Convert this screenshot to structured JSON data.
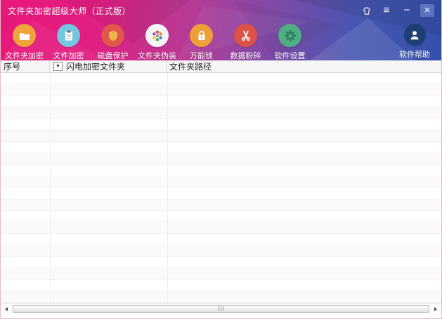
{
  "window": {
    "title": "文件夹加密超级大师（正式版）",
    "controls": {
      "menu": "≡",
      "minimize": "−",
      "close": "×"
    }
  },
  "theme": {
    "gradient_left": "#e9177a",
    "gradient_mid": "#8a48a6",
    "gradient_right": "#3350ab"
  },
  "toolbar": {
    "items": [
      {
        "label": "文件夹加密",
        "icon": "folder-icon",
        "circle_color": "#efa33d"
      },
      {
        "label": "文件加密",
        "icon": "clipboard-icon",
        "circle_color": "#74c6e1"
      },
      {
        "label": "磁盘保护",
        "icon": "shield-icon",
        "circle_color": "#e2574c"
      },
      {
        "label": "文件夹伪装",
        "icon": "color-wheel-icon",
        "circle_color": "#f4f4f4"
      },
      {
        "label": "万能锁",
        "icon": "lock-icon",
        "circle_color": "#ef9f38"
      },
      {
        "label": "数据粉碎",
        "icon": "scissors-icon",
        "circle_color": "#dc5247"
      },
      {
        "label": "软件设置",
        "icon": "gear-icon",
        "circle_color": "#4fae82"
      }
    ],
    "help_item": {
      "label": "软件帮助",
      "icon": "user-icon",
      "circle_color": "#1e3e76"
    }
  },
  "table": {
    "columns": [
      {
        "label": "序号"
      },
      {
        "label": "闪电加密文件夹",
        "dropdown_glyph": "▼"
      },
      {
        "label": "文件夹路径"
      }
    ],
    "rows": [],
    "empty_row_count": 20
  },
  "scrollbar": {
    "left_icon": "scroll-left-icon",
    "right_icon": "scroll-right-icon"
  }
}
